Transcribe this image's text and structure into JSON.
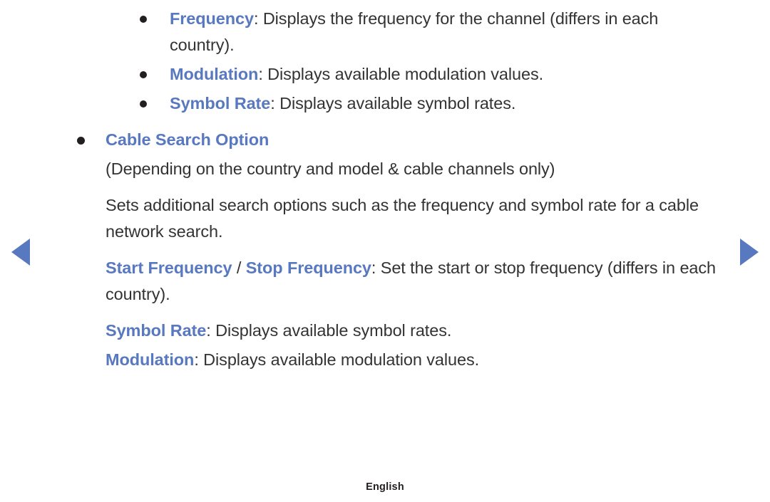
{
  "page": {
    "background_color": "#ffffff",
    "body_text_color": "#333333",
    "keyword_color": "#5878bf",
    "bullet_color": "#231f20"
  },
  "navigation": {
    "prev": {
      "icon": "triangle-left-icon",
      "label": "Previous page"
    },
    "next": {
      "icon": "triangle-right-icon",
      "label": "Next page"
    }
  },
  "content": {
    "sub_items": [
      {
        "keyword": "Frequency",
        "separator": ": ",
        "description": "Displays the frequency for the channel (differs in each country)."
      },
      {
        "keyword": "Modulation",
        "separator": ": ",
        "description": "Displays available modulation values."
      },
      {
        "keyword": "Symbol Rate",
        "separator": ": ",
        "description": "Displays available symbol rates."
      }
    ],
    "section": {
      "heading": "Cable Search Option",
      "note": "(Depending on the country and model & cable channels only)",
      "body": "Sets additional search options such as the frequency and symbol rate for a cable network search.",
      "options": [
        {
          "keyword_a": "Start Frequency",
          "divider": " / ",
          "keyword_b": "Stop Frequency",
          "separator": ": ",
          "description": "Set the start or stop frequency (differs in each country)."
        },
        {
          "keyword_a": "Symbol Rate",
          "separator": ": ",
          "description": "Displays available symbol rates."
        },
        {
          "keyword_a": "Modulation",
          "separator": ": ",
          "description": "Displays available modulation values."
        }
      ]
    }
  },
  "footer": {
    "language": "English"
  }
}
